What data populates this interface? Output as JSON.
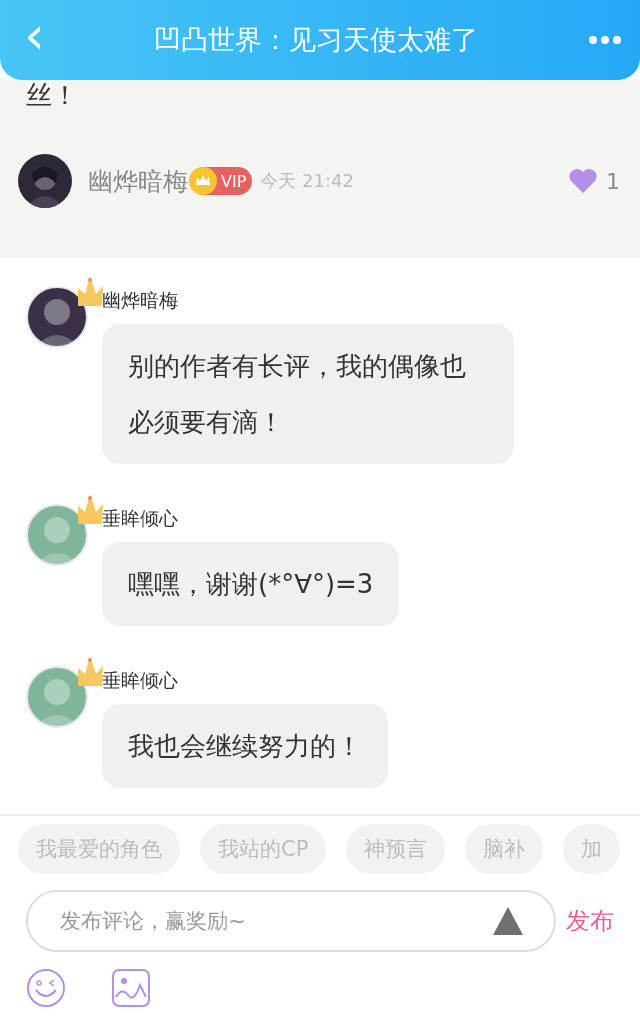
{
  "header": {
    "title": "凹凸世界：见习天使太难了",
    "back": "‹"
  },
  "post": {
    "text_tail": "丝！",
    "author": "幽烨暗梅",
    "vip": "VIP",
    "time": "今天 21:42",
    "likes": "1",
    "liked": true
  },
  "replies": [
    {
      "author": "幽烨暗梅",
      "text": "别的作者有长评，我的偶像也必须要有滴！",
      "color": "#3a3148"
    },
    {
      "author": "垂眸倾心",
      "text": "嘿嘿，谢谢(*°∀°)=3",
      "color": "#7fb59a"
    },
    {
      "author": "垂眸倾心",
      "text": "我也会继续努力的！",
      "color": "#7fb59a"
    }
  ],
  "chips": [
    "我最爱的角色",
    "我站的CP",
    "神预言",
    "脑补",
    "加"
  ],
  "composer": {
    "placeholder": "发布评论，赢奖励~",
    "send": "发布"
  }
}
